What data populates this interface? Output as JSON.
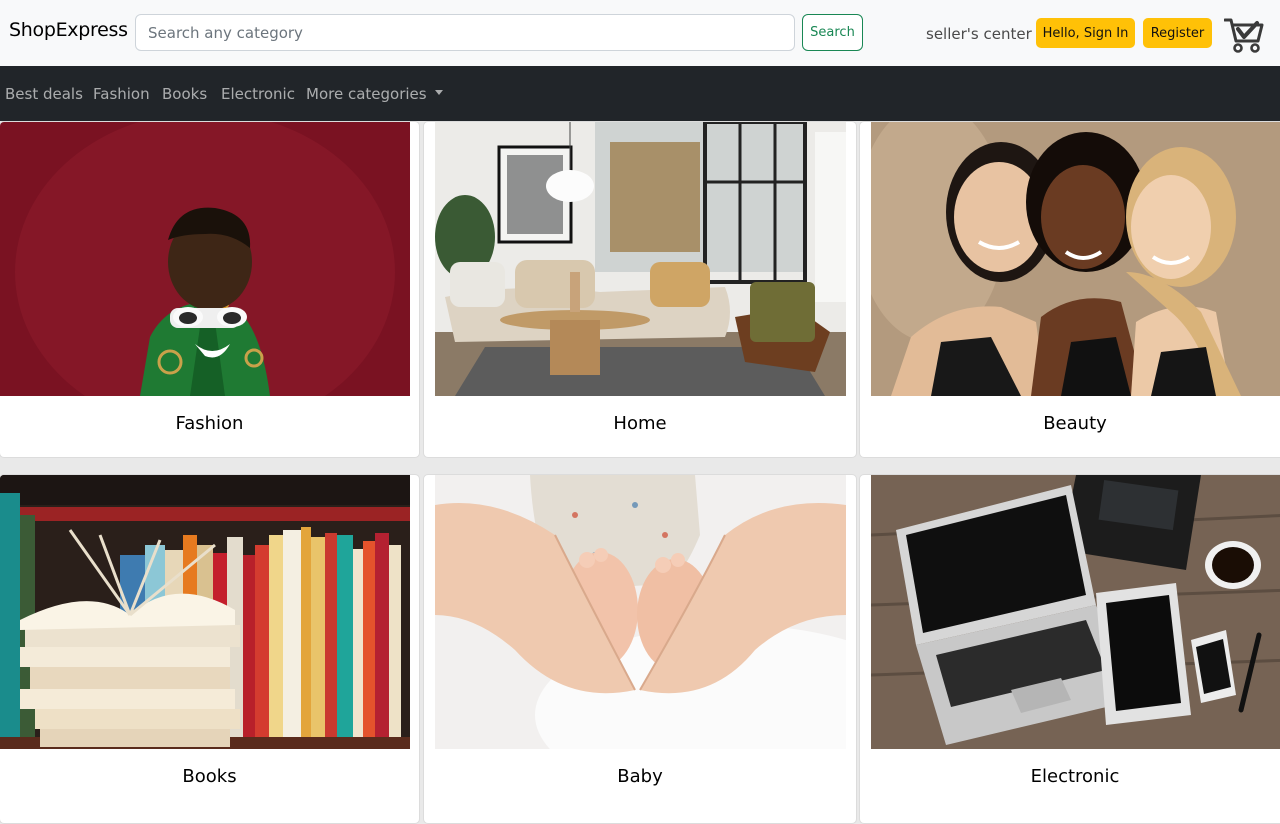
{
  "header": {
    "brand": "ShopExpress",
    "search_placeholder": "Search any category",
    "search_button": "Search",
    "seller_link": "seller's center",
    "signin_button": "Hello, Sign In",
    "register_button": "Register",
    "cart_icon": "shopping-cart-icon"
  },
  "nav": {
    "items": [
      "Best deals",
      "Fashion",
      "Books",
      "Electronic"
    ],
    "dropdown_label": "More categories"
  },
  "categories": [
    {
      "title": "Fashion",
      "image": "woman in green jacket and white sunglasses on red background"
    },
    {
      "title": "Home",
      "image": "living room with beige sofa and round wooden coffee table"
    },
    {
      "title": "Beauty",
      "image": "three smiling women in black tops"
    },
    {
      "title": "Books",
      "image": "stack of open books in front of bookshelf"
    },
    {
      "title": "Baby",
      "image": "hands forming a heart around baby feet"
    },
    {
      "title": "Electronic",
      "image": "laptop, tablet, phone and coffee on wooden desk"
    }
  ],
  "colors": {
    "accent_yellow": "#ffc107",
    "search_green": "#198754",
    "navbar_bg": "#212529"
  }
}
